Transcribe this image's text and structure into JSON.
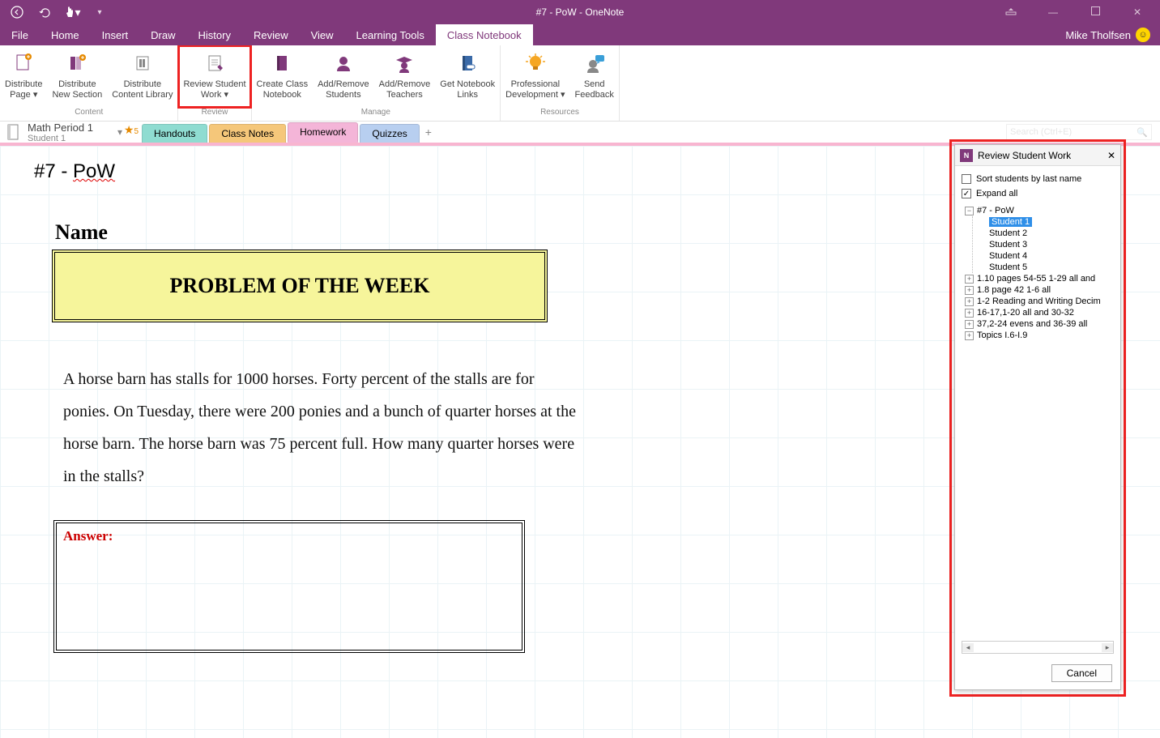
{
  "window": {
    "title": "#7 - PoW - OneNote",
    "user": "Mike Tholfsen"
  },
  "menu": {
    "tabs": [
      "File",
      "Home",
      "Insert",
      "Draw",
      "History",
      "Review",
      "View",
      "Learning Tools",
      "Class Notebook"
    ],
    "active": "Class Notebook"
  },
  "ribbon": {
    "groups": [
      {
        "label": "Content",
        "buttons": [
          {
            "label": "Distribute\nPage ▾",
            "icon": "page"
          },
          {
            "label": "Distribute\nNew Section",
            "icon": "section"
          },
          {
            "label": "Distribute\nContent Library",
            "icon": "library"
          }
        ]
      },
      {
        "label": "Review",
        "buttons": [
          {
            "label": "Review Student\nWork ▾",
            "icon": "review",
            "highlight": true
          }
        ]
      },
      {
        "label": "Manage",
        "buttons": [
          {
            "label": "Create Class\nNotebook",
            "icon": "notebook"
          },
          {
            "label": "Add/Remove\nStudents",
            "icon": "student"
          },
          {
            "label": "Add/Remove\nTeachers",
            "icon": "teacher"
          },
          {
            "label": "Get Notebook\nLinks",
            "icon": "links"
          }
        ]
      },
      {
        "label": "Resources",
        "buttons": [
          {
            "label": "Professional\nDevelopment ▾",
            "icon": "bulb"
          },
          {
            "label": "Send\nFeedback",
            "icon": "feedback"
          }
        ]
      }
    ]
  },
  "notebook": {
    "title": "Math Period 1",
    "subtitle": "Student 1",
    "star": "5"
  },
  "sections": [
    {
      "label": "Handouts",
      "bg": "#8fdcd1"
    },
    {
      "label": "Class Notes",
      "bg": "#f5c77a"
    },
    {
      "label": "Homework",
      "bg": "#f4b5d8",
      "active": true
    },
    {
      "label": "Quizzes",
      "bg": "#b8cff0"
    }
  ],
  "search": {
    "placeholder": "Search (Ctrl+E)"
  },
  "page": {
    "title_a": "#7 - ",
    "title_b": "PoW",
    "name_label": "Name",
    "banner": "PROBLEM OF THE WEEK",
    "problem": "A horse barn has stalls for 1000 horses. Forty percent of the stalls are for ponies. On Tuesday, there were 200 ponies and a bunch of quarter horses at the horse barn. The horse barn was 75 percent full. How many quarter horses were in the stalls?",
    "answer_label": "Answer:"
  },
  "panel": {
    "title": "Review Student Work",
    "sort_label": "Sort students by last name",
    "expand_label": "Expand all",
    "expand_checked": true,
    "cancel": "Cancel",
    "tree_root": "#7 - PoW",
    "students": [
      "Student 1",
      "Student 2",
      "Student 3",
      "Student 4",
      "Student 5"
    ],
    "selected_student": "Student 1",
    "other_assignments": [
      "1.10 pages 54-55 1-29 all and",
      "1.8 page 42 1-6 all",
      "1-2 Reading and Writing Decim",
      "16-17,1-20 all and 30-32",
      "37,2-24 evens and 36-39 all",
      "Topics I.6-I.9"
    ]
  }
}
